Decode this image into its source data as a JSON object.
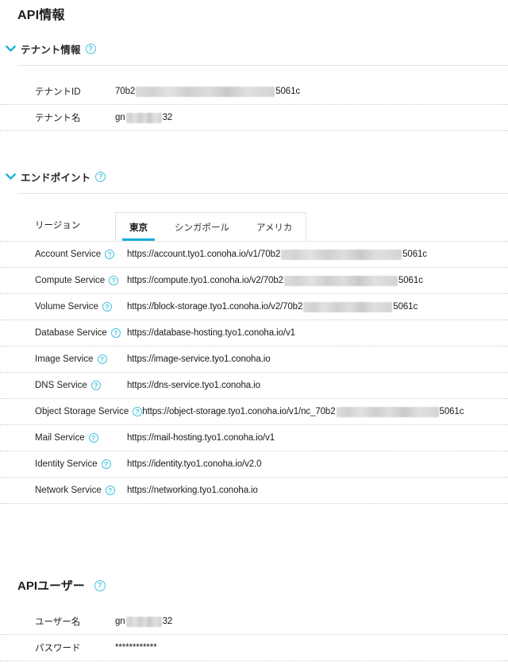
{
  "page": {
    "title": "API情報"
  },
  "sections": {
    "tenant": {
      "label": "テナント情報",
      "help_icon": "help-circle-icon",
      "chevron": "chevron-down-icon",
      "rows": [
        {
          "label": "テナントID",
          "prefix": "70b2",
          "redact_width": 175,
          "suffix": "5061c"
        },
        {
          "label": "テナント名",
          "prefix": "gn",
          "redact_width": 45,
          "suffix": "32"
        }
      ]
    },
    "endpoint": {
      "label": "エンドポイント",
      "help_icon": "help-circle-icon",
      "chevron": "chevron-down-icon",
      "region_label": "リージョン",
      "tabs": [
        {
          "label": "東京",
          "active": true
        },
        {
          "label": "シンガポール",
          "active": false
        },
        {
          "label": "アメリカ",
          "active": false
        }
      ],
      "services": [
        {
          "label": "Account Service",
          "prefix": "https://account.tyo1.conoha.io/v1/70b2",
          "redact_width": 152,
          "suffix": "5061c"
        },
        {
          "label": "Compute Service",
          "prefix": "https://compute.tyo1.conoha.io/v2/70b2",
          "redact_width": 143,
          "suffix": "5061c"
        },
        {
          "label": "Volume Service",
          "prefix": "https://block-storage.tyo1.conoha.io/v2/70b2",
          "redact_width": 112,
          "suffix": "5061c"
        },
        {
          "label": "Database Service",
          "prefix": "https://database-hosting.tyo1.conoha.io/v1",
          "redact_width": 0,
          "suffix": ""
        },
        {
          "label": "Image Service",
          "prefix": "https://image-service.tyo1.conoha.io",
          "redact_width": 0,
          "suffix": ""
        },
        {
          "label": "DNS Service",
          "prefix": "https://dns-service.tyo1.conoha.io",
          "redact_width": 0,
          "suffix": ""
        },
        {
          "label": "Object Storage Service",
          "prefix": "https://object-storage.tyo1.conoha.io/v1/nc_70b2",
          "redact_width": 129,
          "suffix": "5061c"
        },
        {
          "label": "Mail Service",
          "prefix": "https://mail-hosting.tyo1.conoha.io/v1",
          "redact_width": 0,
          "suffix": ""
        },
        {
          "label": "Identity Service",
          "prefix": "https://identity.tyo1.conoha.io/v2.0",
          "redact_width": 0,
          "suffix": ""
        },
        {
          "label": "Network Service",
          "prefix": "https://networking.tyo1.conoha.io",
          "redact_width": 0,
          "suffix": ""
        }
      ]
    },
    "api_user": {
      "title": "APIユーザー",
      "help_icon": "help-circle-icon",
      "rows": [
        {
          "label": "ユーザー名",
          "prefix": "gn",
          "redact_width": 45,
          "suffix": "32"
        },
        {
          "label": "パスワード",
          "prefix": "************",
          "redact_width": 0,
          "suffix": ""
        }
      ]
    }
  },
  "colors": {
    "accent": "#19b0da",
    "help_icon": "#45c3e0",
    "text": "#222222",
    "divider": "#e4e4e4",
    "dotted": "#cfcfcf",
    "background": "#ffffff"
  }
}
